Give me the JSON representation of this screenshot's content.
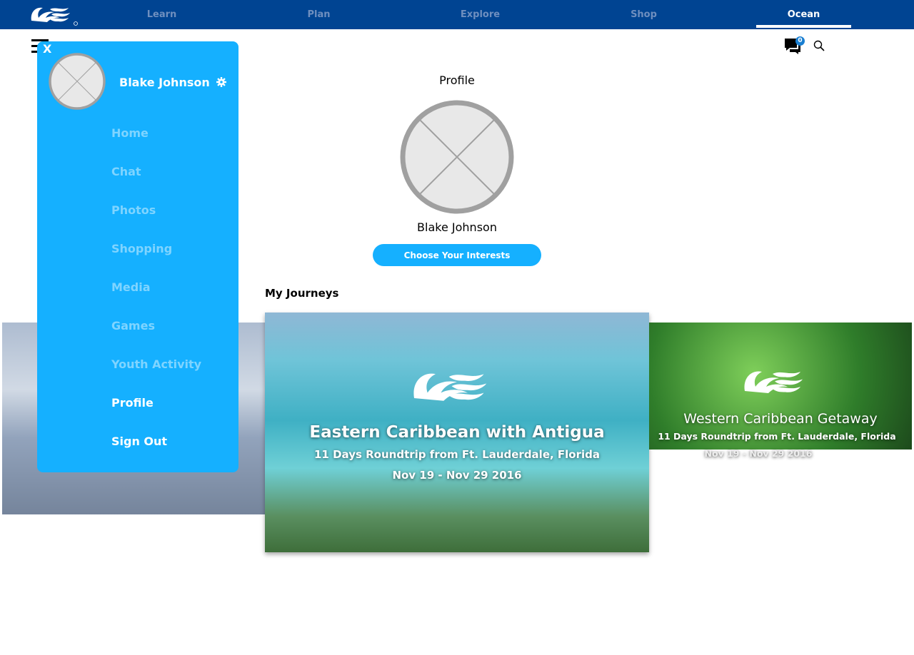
{
  "header": {
    "nav": [
      {
        "label": "Learn",
        "active": false
      },
      {
        "label": "Plan",
        "active": false
      },
      {
        "label": "Explore",
        "active": false
      },
      {
        "label": "Shop",
        "active": false
      },
      {
        "label": "Ocean",
        "active": true
      }
    ],
    "chat_badge": "0"
  },
  "profile": {
    "title": "Profile",
    "name": "Blake Johnson",
    "interests_button": "Choose Your Interests"
  },
  "journeys": {
    "heading": "My Journeys",
    "cards": [
      {
        "title": "Eastern Caribbean with Antigua",
        "subtitle": "11 Days Roundtrip from Ft. Lauderdale, Florida",
        "dates": "Nov 19 - Nov 29 2016"
      },
      {
        "title": "Western Caribbean Getaway",
        "subtitle": "11 Days Roundtrip from Ft. Lauderdale, Florida",
        "dates": "Nov 19 - Nov 29 2016"
      }
    ]
  },
  "menu": {
    "close": "X",
    "name": "Blake Johnson",
    "items": [
      {
        "label": "Home",
        "enabled": false
      },
      {
        "label": "Chat",
        "enabled": false
      },
      {
        "label": "Photos",
        "enabled": false
      },
      {
        "label": "Shopping",
        "enabled": false
      },
      {
        "label": "Media",
        "enabled": false
      },
      {
        "label": "Games",
        "enabled": false
      },
      {
        "label": "Youth Activity",
        "enabled": false
      },
      {
        "label": "Profile",
        "enabled": true
      },
      {
        "label": "Sign Out",
        "enabled": true
      }
    ]
  },
  "colors": {
    "header": "#004492",
    "accent": "#15b0ff",
    "badge": "#1a7fd1"
  }
}
